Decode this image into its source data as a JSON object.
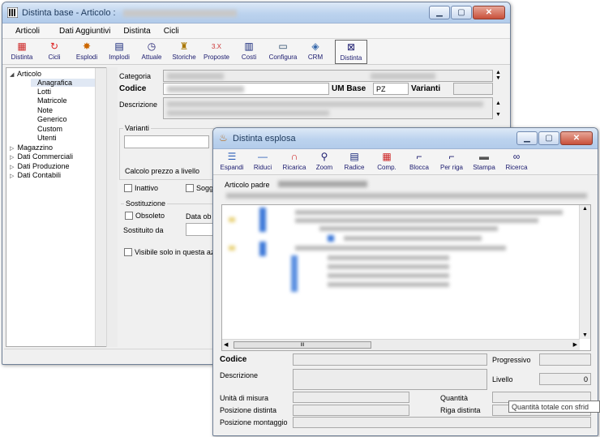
{
  "main_window": {
    "title": "Distinta base - Articolo :",
    "menu": [
      "Articoli",
      "Dati Aggiuntivi",
      "Distinta",
      "Cicli"
    ],
    "toolbar": [
      {
        "label": "Distinta",
        "icon": "bom-grid-icon"
      },
      {
        "label": "Cicli",
        "icon": "refresh-cycle-icon"
      },
      {
        "label": "Esplodi",
        "icon": "explode-icon"
      },
      {
        "label": "Implodi",
        "icon": "implode-grid-icon"
      },
      {
        "label": "Attuale",
        "icon": "clock-icon"
      },
      {
        "label": "Storiche",
        "icon": "castle-icon"
      },
      {
        "label": "Proposte",
        "icon": "proposals-icon"
      },
      {
        "label": "Costi",
        "icon": "costs-grid-icon"
      },
      {
        "label": "Configura",
        "icon": "monitor-icon"
      },
      {
        "label": "CRM",
        "icon": "crm-icon"
      },
      {
        "label": "Distinta",
        "icon": "bom-active-icon"
      }
    ],
    "tree": [
      {
        "label": "Articolo",
        "level": 0,
        "expanded": true,
        "selected": false
      },
      {
        "label": "Anagrafica",
        "level": 1,
        "selected": true
      },
      {
        "label": "Lotti",
        "level": 1
      },
      {
        "label": "Matricole",
        "level": 1
      },
      {
        "label": "Note",
        "level": 1
      },
      {
        "label": "Generico",
        "level": 1
      },
      {
        "label": "Custom",
        "level": 1
      },
      {
        "label": "Utenti",
        "level": 1
      },
      {
        "label": "Magazzino",
        "level": 0,
        "expanded": false
      },
      {
        "label": "Dati Commerciali",
        "level": 0,
        "expanded": false
      },
      {
        "label": "Dati Produzione",
        "level": 0,
        "expanded": false
      },
      {
        "label": "Dati Contabili",
        "level": 0,
        "expanded": false
      }
    ],
    "form": {
      "categoria_label": "Categoria",
      "codice_label": "Codice",
      "um_base_label": "UM Base",
      "um_base_value": "PZ",
      "varianti_label": "Varianti",
      "descrizione_label": "Descrizione",
      "varianti_group": "Varianti",
      "calcolo_label": "Calcolo prezzo a livello",
      "inattivo_label": "Inattivo",
      "sogg_label": "Sogg",
      "sostituzione_group": "Sostituzione",
      "obsoleto_label": "Obsoleto",
      "data_ob_label": "Data ob",
      "sostituito_da_label": "Sostituito da",
      "visibile_label": "Visibile solo in questa az"
    }
  },
  "exploded_window": {
    "title": "Distinta esplosa",
    "toolbar": [
      {
        "label": "Espandi",
        "icon": "expand-lines-icon"
      },
      {
        "label": "Riduci",
        "icon": "reduce-line-icon"
      },
      {
        "label": "Ricarica",
        "icon": "magnet-reload-icon"
      },
      {
        "label": "Zoom",
        "icon": "zoom-tool-icon"
      },
      {
        "label": "Radice",
        "icon": "root-tree-icon"
      },
      {
        "label": "Comp.",
        "icon": "components-icon"
      },
      {
        "label": "Blocca",
        "icon": "lock-corner-icon"
      },
      {
        "label": "Per riga",
        "icon": "row-corner-icon"
      },
      {
        "label": "Stampa",
        "icon": "printer-icon"
      },
      {
        "label": "Ricerca",
        "icon": "binoculars-icon"
      }
    ],
    "articolo_padre_label": "Articolo padre",
    "hscroll_grip": "III",
    "details": {
      "codice_label": "Codice",
      "progressivo_label": "Progressivo",
      "descrizione_label": "Descrizione",
      "livello_label": "Livello",
      "livello_value": "0",
      "unita_label": "Unità di misura",
      "quantita_label": "Quantità",
      "posizione_distinta_label": "Posizione distinta",
      "riga_distinta_label": "Riga distinta",
      "posizione_montaggio_label": "Posizione montaggio"
    },
    "tooltip": "Quantità totale con sfrid"
  },
  "colors": {
    "title_text": "#1e395b",
    "toolbar_text": "#1a1a6e",
    "selection": "#e0e8f4"
  }
}
